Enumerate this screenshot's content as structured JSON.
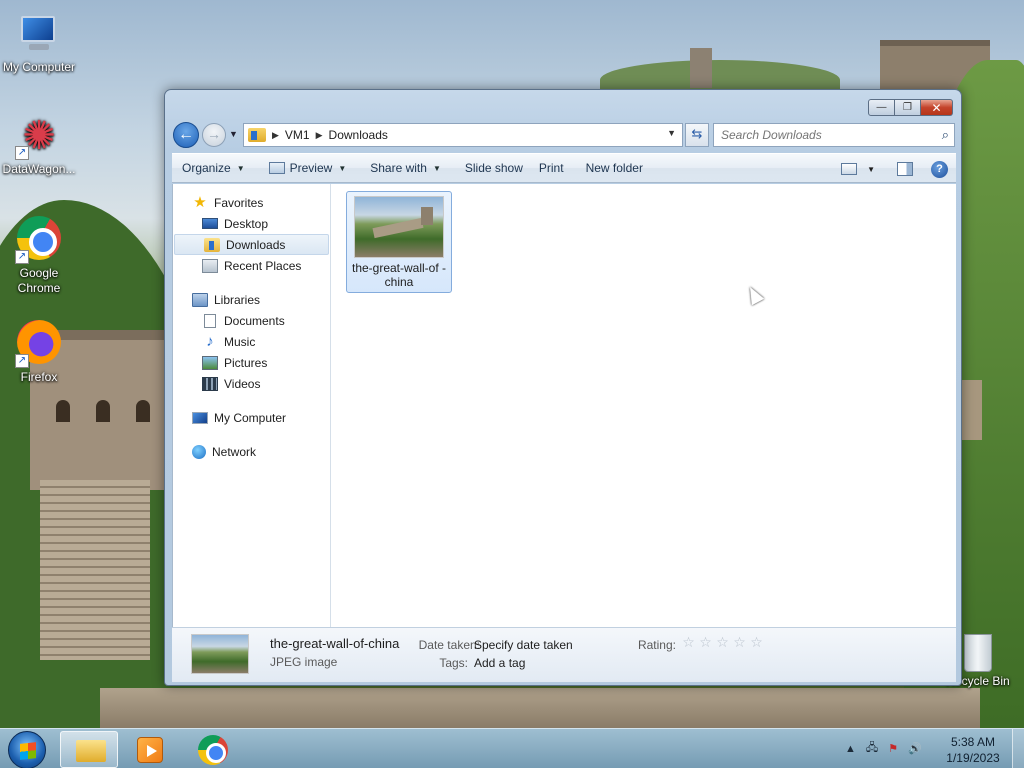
{
  "desktop": {
    "icons": [
      {
        "label": "My Computer",
        "icon": "computer-icon"
      },
      {
        "label": "DataWagon...",
        "icon": "datawagon-icon"
      },
      {
        "label": "Google Chrome",
        "icon": "chrome-icon"
      },
      {
        "label": "Firefox",
        "icon": "firefox-icon"
      },
      {
        "label": "Recycle Bin",
        "icon": "recycle-bin-icon"
      }
    ]
  },
  "window": {
    "buttons": {
      "minimize": "—",
      "maximize": "❐",
      "close": "✕"
    },
    "address": {
      "crumbs": [
        "VM1",
        "Downloads"
      ],
      "separator": "▶"
    },
    "search": {
      "placeholder": "Search Downloads"
    },
    "commands": {
      "organize": "Organize",
      "preview": "Preview",
      "share_with": "Share with",
      "slide_show": "Slide show",
      "print": "Print",
      "new_folder": "New folder"
    },
    "nav": {
      "favorites": "Favorites",
      "desktop": "Desktop",
      "downloads": "Downloads",
      "recent_places": "Recent Places",
      "libraries": "Libraries",
      "documents": "Documents",
      "music": "Music",
      "pictures": "Pictures",
      "videos": "Videos",
      "my_computer": "My Computer",
      "network": "Network"
    },
    "files": [
      {
        "name": "the-great-wall-of-china",
        "display_name": "the-great-wall-of -china",
        "selected": true
      }
    ],
    "details": {
      "name": "the-great-wall-of-china",
      "type": "JPEG image",
      "date_taken_label": "Date taken:",
      "date_taken_value": "Specify date taken",
      "tags_label": "Tags:",
      "tags_value": "Add a tag",
      "rating_label": "Rating:",
      "rating": 0,
      "rating_max": 5
    }
  },
  "taskbar": {
    "time": "5:38 AM",
    "date": "1/19/2023",
    "pinned": [
      "windows-explorer",
      "media-player",
      "google-chrome"
    ],
    "active": "windows-explorer"
  },
  "colors": {
    "selection": "#d6e7fb",
    "accent": "#1d5fb6",
    "close_button": "#c4432b"
  }
}
